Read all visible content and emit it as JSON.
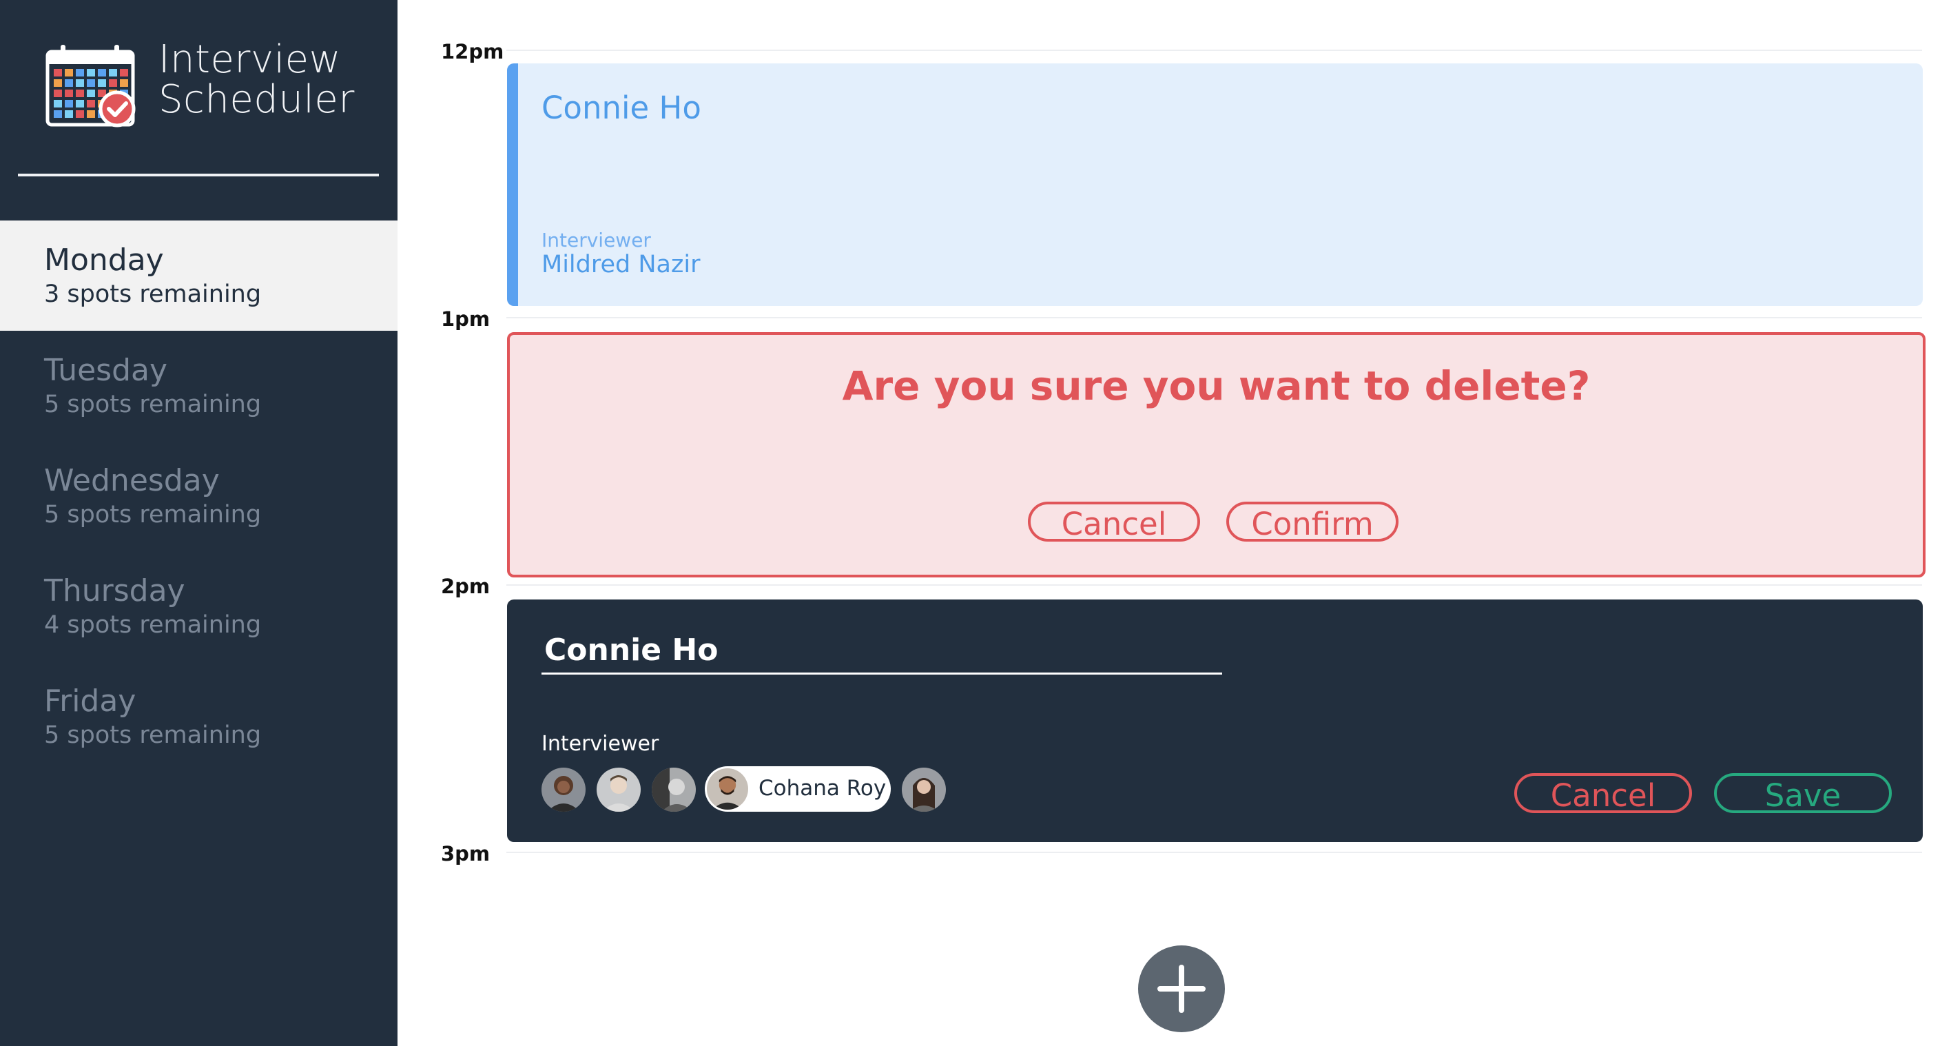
{
  "app": {
    "title_line1": "Interview",
    "title_line2": "Scheduler"
  },
  "days": [
    {
      "name": "Monday",
      "spots": "3 spots remaining",
      "selected": true
    },
    {
      "name": "Tuesday",
      "spots": "5 spots remaining",
      "selected": false
    },
    {
      "name": "Wednesday",
      "spots": "5 spots remaining",
      "selected": false
    },
    {
      "name": "Thursday",
      "spots": "4 spots remaining",
      "selected": false
    },
    {
      "name": "Friday",
      "spots": "5 spots remaining",
      "selected": false
    }
  ],
  "times": [
    "12pm",
    "1pm",
    "2pm",
    "3pm"
  ],
  "appointment_show": {
    "student": "Connie Ho",
    "interviewer_label": "Interviewer",
    "interviewer_name": "Mildred Nazir"
  },
  "confirm": {
    "message": "Are you sure you want to delete?",
    "cancel_label": "Cancel",
    "confirm_label": "Confirm"
  },
  "form": {
    "student_value": "Connie Ho",
    "interviewer_label": "Interviewer",
    "selected_interviewer": "Cohana Roy",
    "cancel_label": "Cancel",
    "save_label": "Save"
  },
  "colors": {
    "sidebar_bg": "#222f3e",
    "show_bg": "#e3effc",
    "show_accent": "#5aa1f0",
    "danger": "#e05559",
    "confirm_green": "#26a97f",
    "add_button": "#5c6670"
  },
  "icons": {
    "logo": "calendar-check-icon",
    "add": "plus-icon"
  }
}
